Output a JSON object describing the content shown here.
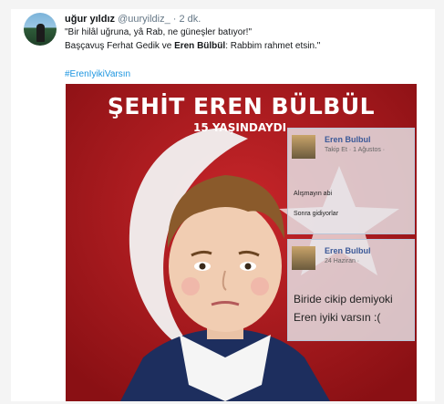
{
  "tweet": {
    "display_name": "uğur yıldız",
    "handle": "@uuryildiz_",
    "separator": "·",
    "time": "2 dk.",
    "line1": "\"Bir hilâl uğruna, yâ Rab, ne güneşler batıyor!\"",
    "line2_prefix": "Başçavuş Ferhat Gedik ve ",
    "line2_bold": "Eren Bülbül",
    "line2_suffix": ": Rabbim rahmet etsin.\"",
    "hashtag": "#ErenIyikiVarsın"
  },
  "poster": {
    "title": "ŞEHİT EREN BÜLBÜL",
    "age": "15 YAŞINDAYDI"
  },
  "fb_card1": {
    "name": "Eren Bulbul",
    "meta": "Takip Et · 1 Ağustos ·",
    "body1": "Alışmayın abi",
    "body2": "Sonra gidiyorlar"
  },
  "fb_card2": {
    "name": "Eren Bulbul",
    "meta": "24 Haziran ·",
    "body1": "Biride cikip demiyoki",
    "body2": "Eren iyiki varsın :("
  }
}
